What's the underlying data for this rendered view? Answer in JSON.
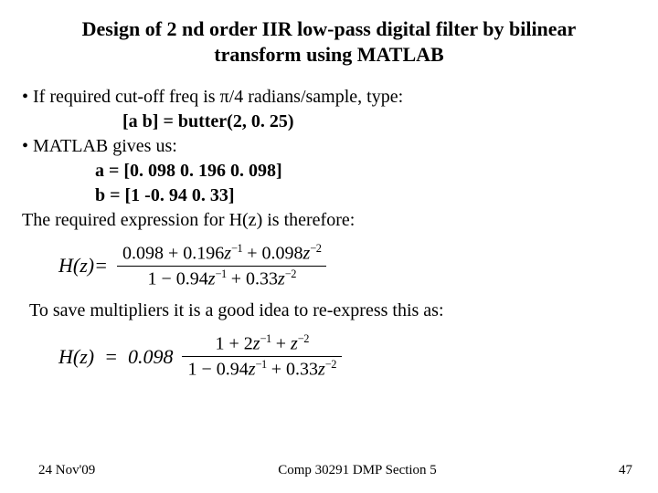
{
  "title": "Design of 2 nd order IIR low-pass digital filter by bilinear transform using MATLAB",
  "lines": {
    "l1": "• If required cut-off freq is π/4 radians/sample, type:",
    "l2": "[a b] = butter(2, 0. 25)",
    "l3": "• MATLAB gives us:",
    "l4": "a = [0. 098   0. 196   0. 098]",
    "l5": "b = [1   -0. 94   0. 33]",
    "l6": "The required expression for H(z) is therefore:"
  },
  "eq1": {
    "lhs": "H(z) =",
    "num_a": "0.098 + 0.196",
    "num_b": " + 0.098",
    "den_a": "1 − 0.94",
    "den_b": " + 0.33"
  },
  "save_line": "To save multipliers it is a good idea to re-express this as:",
  "eq2": {
    "lhs": "H(z)   =   0.098",
    "num_a": "1   +   2",
    "num_b": "   +   ",
    "den_a": "1 − 0.94",
    "den_b": " + 0.33"
  },
  "footer": {
    "left": "24 Nov'09",
    "center": "Comp 30291 DMP Section 5",
    "right": "47"
  }
}
